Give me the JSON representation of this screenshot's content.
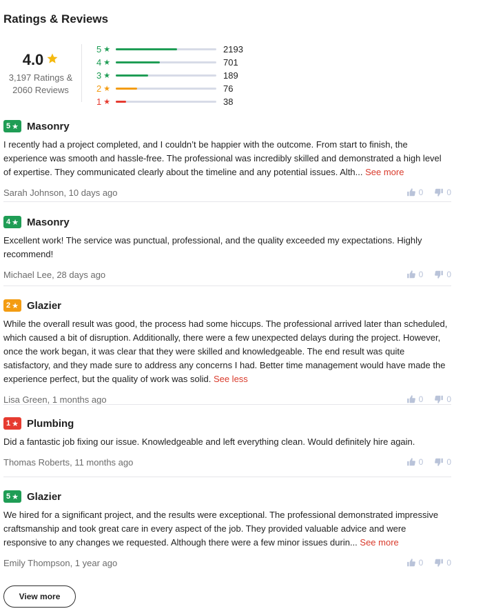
{
  "section_title": "Ratings & Reviews",
  "summary": {
    "average": "4.0",
    "count_line1": "3,197 Ratings &",
    "count_line2": "2060 Reviews",
    "distribution": [
      {
        "stars": "5",
        "count": "2193",
        "fraction": 0.61,
        "color": "#1f9d55"
      },
      {
        "stars": "4",
        "count": "701",
        "fraction": 0.44,
        "color": "#1f9d55"
      },
      {
        "stars": "3",
        "count": "189",
        "fraction": 0.32,
        "color": "#1f9d55"
      },
      {
        "stars": "2",
        "count": "76",
        "fraction": 0.21,
        "color": "#f39c12"
      },
      {
        "stars": "1",
        "count": "38",
        "fraction": 0.1,
        "color": "#e63b30"
      }
    ]
  },
  "star_color": "#f5b90f",
  "reviews": [
    {
      "rating": "5",
      "badge_color": "#1f9d55",
      "category": "Masonry",
      "text": "I recently had a project completed, and I couldn’t be happier with the outcome. From start to finish, the experience was smooth and hassle-free. The professional was incredibly skilled and demonstrated a high level of expertise. They communicated clearly about the timeline and any potential issues. Alth... ",
      "link": "See more",
      "author": "Sarah Johnson, 10 days ago",
      "likes": "0",
      "dislikes": "0"
    },
    {
      "rating": "4",
      "badge_color": "#1f9d55",
      "category": "Masonry",
      "text": "Excellent work! The service was punctual, professional, and the quality exceeded my expectations. Highly recommend!",
      "link": "",
      "author": "Michael Lee, 28 days ago",
      "likes": "0",
      "dislikes": "0"
    },
    {
      "rating": "2",
      "badge_color": "#f39c12",
      "category": "Glazier",
      "text": "While the overall result was good, the process had some hiccups. The professional arrived later than scheduled, which caused a bit of disruption. Additionally, there were a few unexpected delays during the project. However, once the work began, it was clear that they were skilled and knowledgeable. The end result was quite satisfactory, and they made sure to address any concerns I had. Better time management would have made the experience perfect, but the quality of work was solid. ",
      "link": "See less",
      "author": "Lisa Green, 1 months ago",
      "likes": "0",
      "dislikes": "0"
    },
    {
      "rating": "1",
      "badge_color": "#e63b30",
      "category": "Plumbing",
      "text": "Did a fantastic job fixing our issue. Knowledgeable and left everything clean. Would definitely hire again.",
      "link": "",
      "author": "Thomas Roberts, 11 months ago",
      "likes": "0",
      "dislikes": "0"
    },
    {
      "rating": "5",
      "badge_color": "#1f9d55",
      "category": "Glazier",
      "text": "We hired for a significant project, and the results were exceptional. The professional demonstrated impressive craftsmanship and took great care in every aspect of the job. They provided valuable advice and were responsive to any changes we requested. Although there were a few minor issues durin... ",
      "link": "See more",
      "author": "Emily Thompson, 1 year ago",
      "likes": "0",
      "dislikes": "0"
    }
  ],
  "view_more_label": "View more",
  "icons": {
    "star": "star-icon",
    "like": "thumbs-up-icon",
    "dislike": "thumbs-down-icon"
  }
}
